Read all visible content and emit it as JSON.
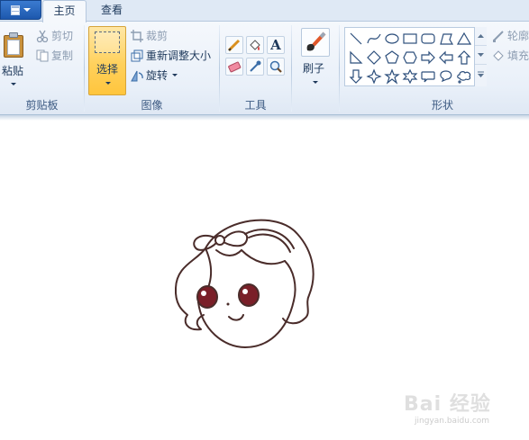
{
  "tabs": [
    {
      "label": "主页"
    },
    {
      "label": "查看"
    }
  ],
  "clipboard": {
    "paste_label": "粘贴",
    "cut_label": "剪切",
    "copy_label": "复制",
    "group_label": "剪贴板"
  },
  "image": {
    "select_label": "选择",
    "crop_label": "裁剪",
    "resize_label": "重新调整大小",
    "rotate_label": "旋转",
    "group_label": "图像"
  },
  "tools": {
    "items": [
      "pencil-icon",
      "fill-icon",
      "text-icon",
      "eraser-icon",
      "color-picker-icon",
      "magnifier-icon"
    ],
    "group_label": "工具"
  },
  "brushes": {
    "label": "刷子"
  },
  "shapes": {
    "items": [
      "line",
      "curve",
      "oval",
      "rectangle",
      "rounded-rectangle",
      "polygon",
      "triangle",
      "right-triangle",
      "diamond",
      "pentagon",
      "hexagon",
      "right-arrow",
      "left-arrow",
      "up-arrow",
      "down-arrow",
      "four-point-star",
      "five-point-star",
      "six-point-star",
      "rounded-callout",
      "oval-callout",
      "cloud-callout"
    ],
    "outline_label": "轮廓",
    "fill_label": "填充",
    "group_label": "形状"
  },
  "watermark": {
    "main": "Bai 经验",
    "sub": "jingyan.baidu.com"
  },
  "colors": {
    "ribbon_bg": "#e9f0f9",
    "tab_strip": "#dfe9f5",
    "app_button": "#2a67c0",
    "select_active": "#ffd15c",
    "text": "#1e395b",
    "drawing_stroke": "#4a2c2a",
    "eye_color": "#7a1f28"
  }
}
